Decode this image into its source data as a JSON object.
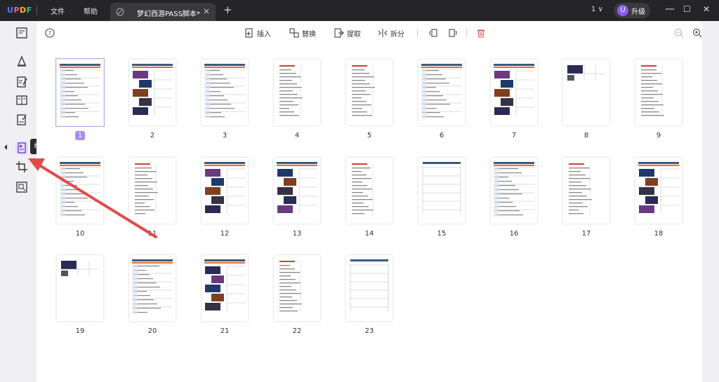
{
  "app": {
    "logo": [
      "U",
      "P",
      "D",
      "F"
    ]
  },
  "menu": {
    "file": "文件",
    "help": "帮助"
  },
  "tab": {
    "title": "梦幻西游PASS脚本*",
    "close": "×",
    "add": "+"
  },
  "titlebar": {
    "page_count": "1 ∨",
    "avatar_letter": "U",
    "upgrade_label": "升级"
  },
  "window": {
    "minimize": "—",
    "maximize": "☐",
    "close": "✕"
  },
  "sidebar": {
    "tooltip": "组织页面"
  },
  "toolbar": {
    "insert": "插入",
    "replace": "替换",
    "extract": "提取",
    "split": "拆分"
  },
  "pages": [
    "1",
    "2",
    "3",
    "4",
    "5",
    "6",
    "7",
    "8",
    "9",
    "10",
    "11",
    "12",
    "13",
    "14",
    "15",
    "16",
    "17",
    "18",
    "19",
    "20",
    "21",
    "22",
    "23"
  ],
  "selected_page": "1",
  "colors": {
    "accent": "#8b5cf6",
    "arrow": "#e24a4a",
    "delete": "#e5484d"
  }
}
